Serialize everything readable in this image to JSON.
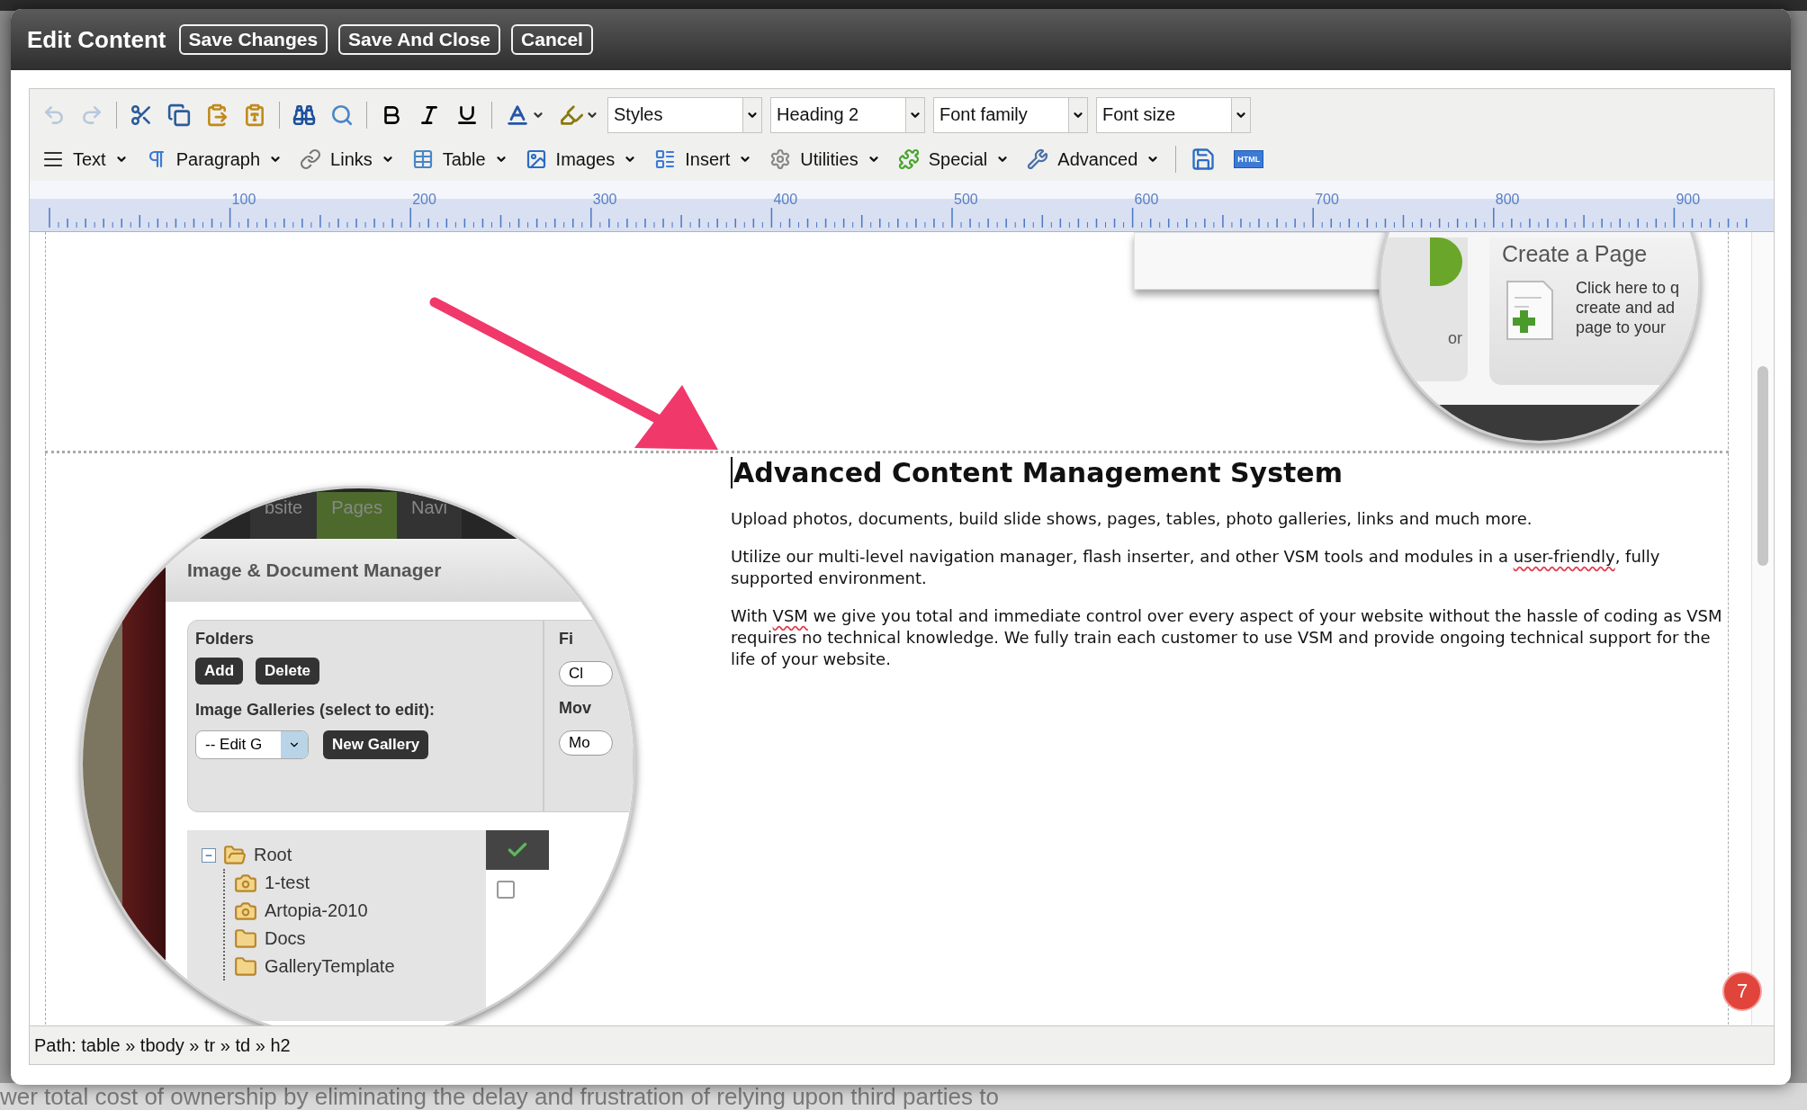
{
  "window": {
    "title": "Edit Content",
    "buttons": [
      "Save Changes",
      "Save And Close",
      "Cancel"
    ]
  },
  "toolbar": {
    "row1": [
      {
        "kind": "button",
        "disabled": true
      },
      {
        "kind": "button",
        "disabled": true
      },
      {
        "kind": "separator"
      },
      {
        "kind": "button",
        "disabled": false
      },
      {
        "kind": "button",
        "disabled": false
      },
      {
        "kind": "button",
        "disabled": false
      },
      {
        "kind": "button",
        "disabled": false
      },
      {
        "kind": "separator"
      },
      {
        "kind": "button",
        "disabled": false
      },
      {
        "kind": "button",
        "disabled": false
      },
      {
        "kind": "separator"
      },
      {
        "kind": "button",
        "disabled": false
      },
      {
        "kind": "button",
        "disabled": false
      },
      {
        "kind": "button",
        "disabled": false
      },
      {
        "kind": "separator"
      },
      {
        "kind": "split",
        "disabled": false
      },
      {
        "kind": "split",
        "disabled": false
      },
      {
        "kind": "select",
        "label": "Styles"
      },
      {
        "kind": "select",
        "label": "Heading 2"
      },
      {
        "kind": "select",
        "label": "Font family"
      },
      {
        "kind": "select",
        "label": "Font size"
      }
    ],
    "row2": [
      {
        "kind": "menu",
        "label": "Text"
      },
      {
        "kind": "menu",
        "label": "Paragraph"
      },
      {
        "kind": "menu",
        "label": "Links"
      },
      {
        "kind": "menu",
        "label": "Table"
      },
      {
        "kind": "menu",
        "label": "Images"
      },
      {
        "kind": "menu",
        "label": "Insert"
      },
      {
        "kind": "menu",
        "label": "Utilities"
      },
      {
        "kind": "menu",
        "label": "Special"
      },
      {
        "kind": "menu",
        "label": "Advanced"
      },
      {
        "kind": "separator"
      },
      {
        "kind": "button",
        "disabled": false
      },
      {
        "kind": "badge",
        "label": "HTML"
      }
    ]
  },
  "ruler": {
    "labels": [
      "100",
      "200",
      "300",
      "400",
      "500",
      "600",
      "700",
      "800",
      "900"
    ]
  },
  "content": {
    "top_image": {
      "side_text": "or",
      "heading": "Create a Page",
      "lines": [
        "Click here to q",
        "create and ad",
        "page to your"
      ]
    },
    "left_image": {
      "tabs": [
        {
          "label": "bsite",
          "selected": false
        },
        {
          "label": "Pages",
          "selected": true
        },
        {
          "label": "Navi",
          "selected": false
        }
      ],
      "title": "Image & Document Manager",
      "folders_label": "Folders",
      "folder_buttons": [
        "Add",
        "Delete"
      ],
      "galleries_label": "Image Galleries (select to edit):",
      "gallery_select": "-- Edit G",
      "new_gallery": "New Gallery",
      "checkbox_checked": false,
      "side_heading": "Fi",
      "side_button": "Cl",
      "side_label": "Mov",
      "side_select": "Mo",
      "tree": [
        {
          "label": "Root",
          "kind": "folder",
          "expanded": true,
          "children": [
            {
              "label": "1-test",
              "kind": "gallery"
            },
            {
              "label": "Artopia-2010",
              "kind": "gallery"
            },
            {
              "label": "Docs",
              "kind": "folder"
            },
            {
              "label": "GalleryTemplate",
              "kind": "folder"
            }
          ]
        }
      ]
    },
    "heading": "Advanced Content Management System",
    "paragraphs": [
      [
        {
          "text": "Upload photos, documents, build slide shows, pages, tables, photo galleries, links and much more.",
          "misspelled": false
        }
      ],
      [
        {
          "text": "Utilize our multi-level navigation manager, flash inserter, and other VSM tools and modules in a ",
          "misspelled": false
        },
        {
          "text": "user-friendly",
          "misspelled": true
        },
        {
          "text": ", fully supported environment.",
          "misspelled": false
        }
      ],
      [
        {
          "text": "With ",
          "misspelled": false
        },
        {
          "text": "VSM",
          "misspelled": true
        },
        {
          "text": " we give you total and immediate control over every aspect of your website without the hassle of coding as VSM requires no technical knowledge. We fully train each customer to use VSM and provide ongoing technical support for the life of your website.",
          "misspelled": false
        }
      ]
    ],
    "badge": "7"
  },
  "status_bar": "Path: table » tbody » tr » td » h2",
  "backdrop_text": "wer total cost of ownership by eliminating the delay and frustration of relying upon third parties to"
}
